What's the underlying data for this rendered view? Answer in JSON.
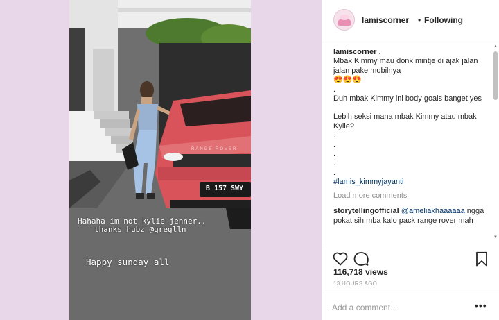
{
  "media": {
    "story_caption_line1": "Hahaha im not kylie jenner..",
    "story_caption_line2": "thanks hubz @greglln",
    "story_caption_line3": "Happy sunday all",
    "plate": "B 157 SWY",
    "car_badge": "RANGE ROVER",
    "colors": {
      "background": "#e7d7e8",
      "car": "#d8545a"
    }
  },
  "header": {
    "username": "lamiscorner",
    "separator": "•",
    "follow_state": "Following"
  },
  "caption": {
    "username": "lamiscorner",
    "username_suffix": " .",
    "line1": "Mbak Kimmy mau donk mintje di ajak jalan jalan pake mobilnya",
    "emojis": "😍😍😍",
    "dot1": ".",
    "line2": "Duh mbak Kimmy ini body goals banget yes",
    "line3": "Lebih seksi mana mbak Kimmy atau mbak Kylie?",
    "dots": [
      ".",
      ".",
      ".",
      ".",
      "."
    ],
    "hashtag": "#lamis_kimmyjayanti"
  },
  "load_more": "Load more comments",
  "comment": {
    "username": "storytellingofficial",
    "mention": "@ameliakhaaaaaa",
    "text": " ngga pokat sih mba kalo pack range rover mah"
  },
  "actions": {
    "like_icon": "heart-icon",
    "comment_icon": "comment-bubble-icon",
    "save_icon": "bookmark-icon"
  },
  "views": "116,718 views",
  "timestamp": "13 HOURS AGO",
  "add_comment": {
    "placeholder": "Add a comment...",
    "options": "•••"
  }
}
